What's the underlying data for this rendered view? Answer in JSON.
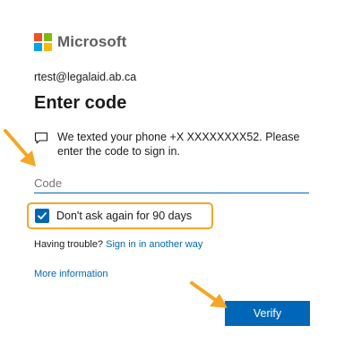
{
  "brand": {
    "name": "Microsoft",
    "logo_colors": [
      "#f25022",
      "#7fba00",
      "#00a4ef",
      "#ffb900"
    ]
  },
  "user": {
    "email": "rtest@legalaid.ab.ca"
  },
  "title": "Enter code",
  "message": {
    "icon": "message-icon",
    "text": "We texted your phone +X XXXXXXXX52. Please enter the code to sign in."
  },
  "code_input": {
    "placeholder": "Code",
    "value": ""
  },
  "remember": {
    "label": "Don't ask again for 90 days",
    "checked": true
  },
  "trouble": {
    "prefix": "Having trouble?",
    "link": "Sign in in another way"
  },
  "more_info": "More information",
  "verify_label": "Verify",
  "colors": {
    "accent": "#0067b8",
    "highlight": "#f5a623",
    "annotation_arrow": "#f5a623"
  }
}
